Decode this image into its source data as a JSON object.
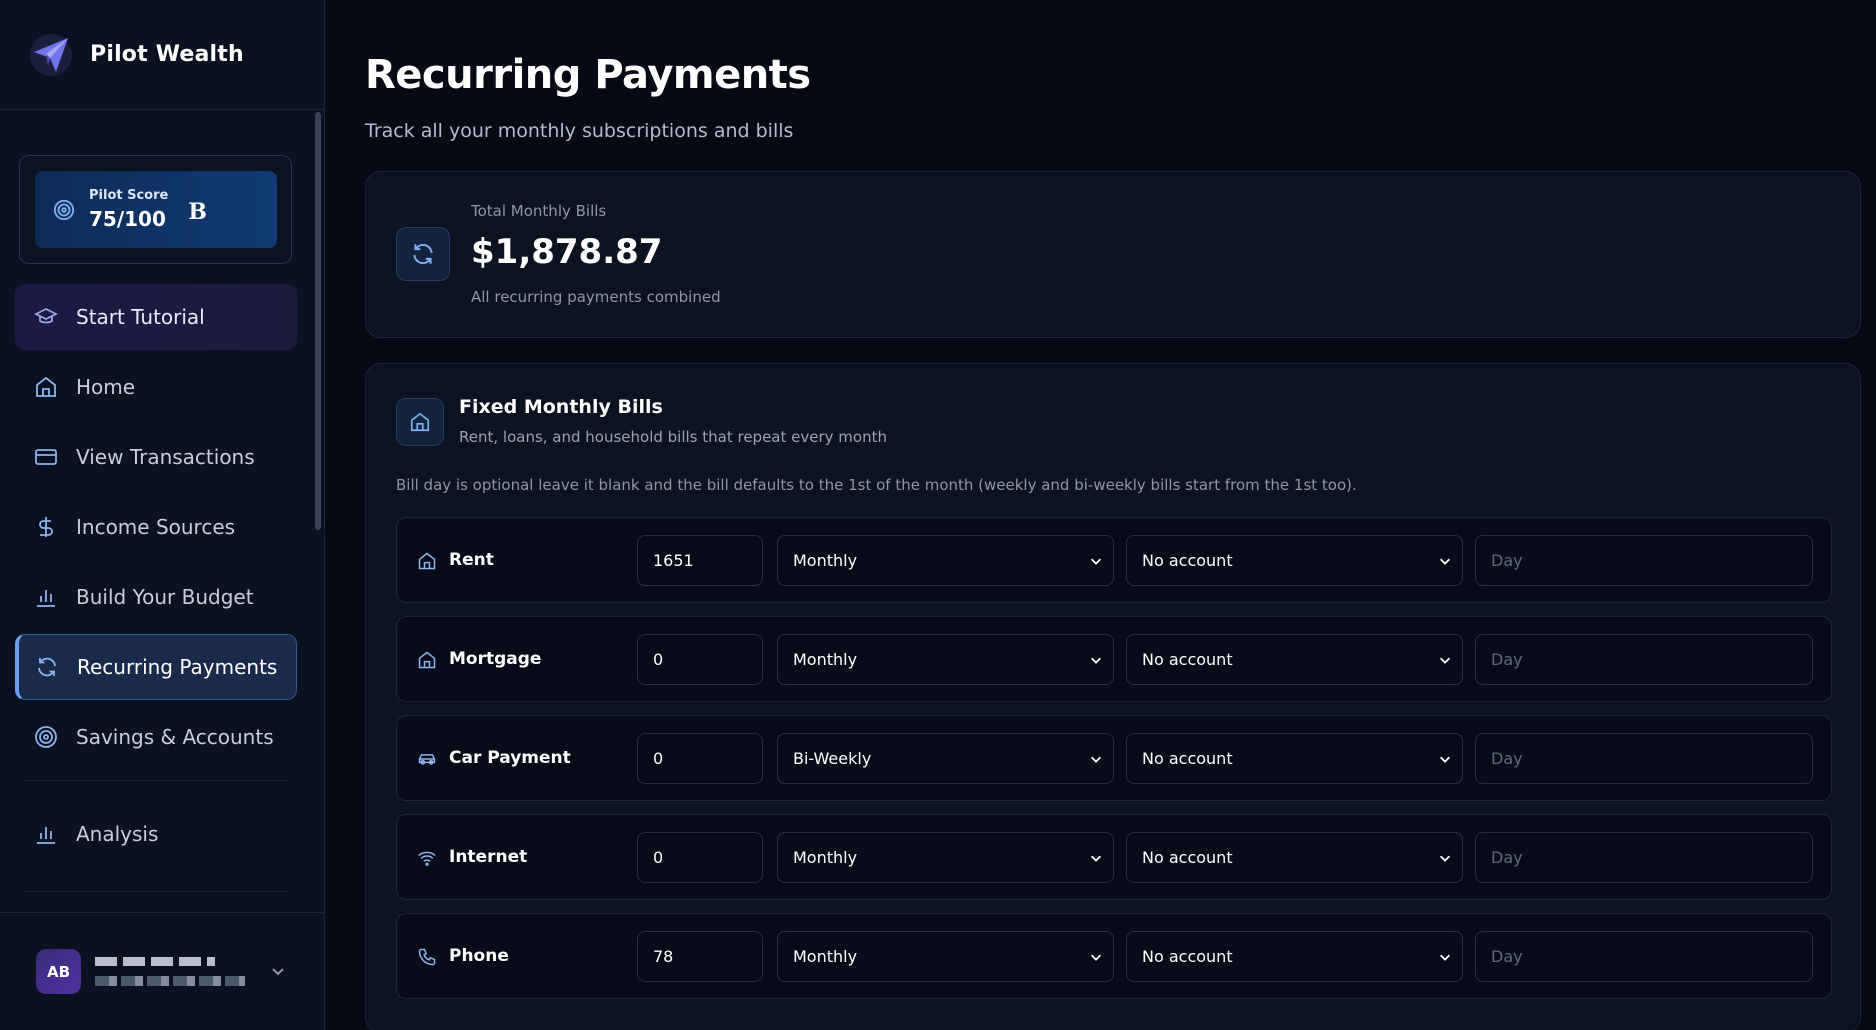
{
  "brand": {
    "name": "Pilot Wealth"
  },
  "score": {
    "label": "Pilot Score",
    "value": "75/100",
    "grade": "B"
  },
  "nav": {
    "tutorial": "Start Tutorial",
    "home": "Home",
    "transactions": "View Transactions",
    "income": "Income Sources",
    "budget": "Build Your Budget",
    "recurring": "Recurring Payments",
    "savings": "Savings & Accounts",
    "analysis": "Analysis"
  },
  "user": {
    "initials": "AB"
  },
  "page": {
    "title": "Recurring Payments",
    "subtitle": "Track all your monthly subscriptions and bills"
  },
  "total": {
    "label": "Total Monthly Bills",
    "value": "$1,878.87",
    "note": "All recurring payments combined"
  },
  "fixed": {
    "title": "Fixed Monthly Bills",
    "subtitle": "Rent, loans, and household bills that repeat every month",
    "note": "Bill day is optional leave it blank and the bill defaults to the 1st of the month (weekly and bi-weekly bills start from the 1st too).",
    "rows": [
      {
        "name": "Rent",
        "icon": "house-icon",
        "amount": "1651",
        "frequency": "Monthly",
        "account": "No account",
        "day_placeholder": "Day"
      },
      {
        "name": "Mortgage",
        "icon": "house-icon",
        "amount": "0",
        "frequency": "Monthly",
        "account": "No account",
        "day_placeholder": "Day"
      },
      {
        "name": "Car Payment",
        "icon": "car-icon",
        "amount": "0",
        "frequency": "Bi-Weekly",
        "account": "No account",
        "day_placeholder": "Day"
      },
      {
        "name": "Internet",
        "icon": "wifi-icon",
        "amount": "0",
        "frequency": "Monthly",
        "account": "No account",
        "day_placeholder": "Day"
      },
      {
        "name": "Phone",
        "icon": "phone-icon",
        "amount": "78",
        "frequency": "Monthly",
        "account": "No account",
        "day_placeholder": "Day"
      }
    ]
  },
  "colors": {
    "accent": "#7fb0f2",
    "active_nav": "#1a2a4a",
    "background": "#060a14"
  }
}
